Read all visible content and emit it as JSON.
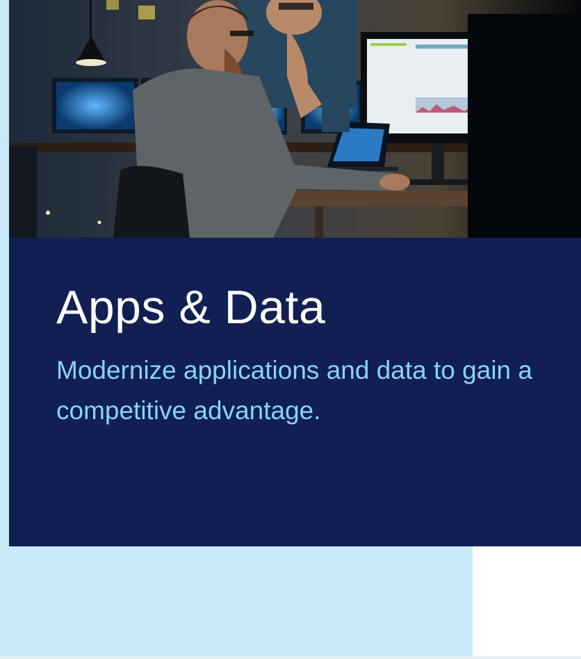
{
  "hero": {
    "image_description_icon": "office-photo-icon"
  },
  "card": {
    "title": "Apps & Data",
    "subtitle": "Modernize applications and data to gain a competitive advantage."
  },
  "colors": {
    "page_background": "#c9eaf9",
    "card_background": "#111f52",
    "title": "#ffffff",
    "subtitle": "#88d4f7"
  }
}
